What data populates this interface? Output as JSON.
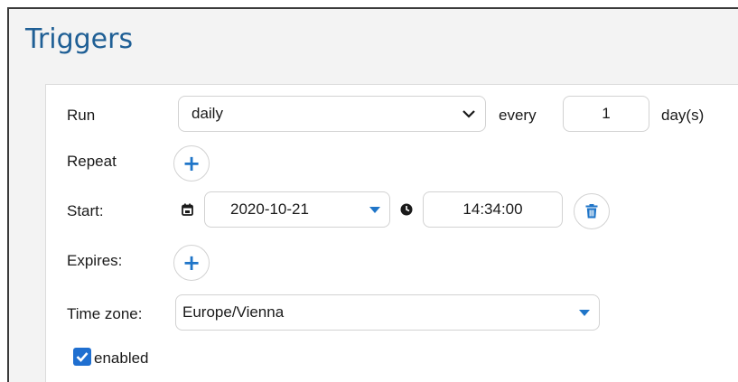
{
  "title": "Triggers",
  "run": {
    "label": "Run",
    "frequency": "daily",
    "every_label": "every",
    "interval": "1",
    "unit_label": "day(s)"
  },
  "repeat": {
    "label": "Repeat",
    "button_icon": "plus-icon"
  },
  "start": {
    "label": "Start:",
    "date_icon": "calendar-icon",
    "date": "2020-10-21",
    "time_icon": "clock-icon",
    "time": "14:34:00",
    "delete_icon": "trash-icon"
  },
  "expires": {
    "label": "Expires:",
    "button_icon": "plus-icon"
  },
  "timezone": {
    "label": "Time zone:",
    "value": "Europe/Vienna"
  },
  "enabled": {
    "label": "enabled",
    "checked": true
  },
  "colors": {
    "accent": "#1f75c8",
    "title": "#1f5f95",
    "panel_bg": "#f3f3f3"
  }
}
